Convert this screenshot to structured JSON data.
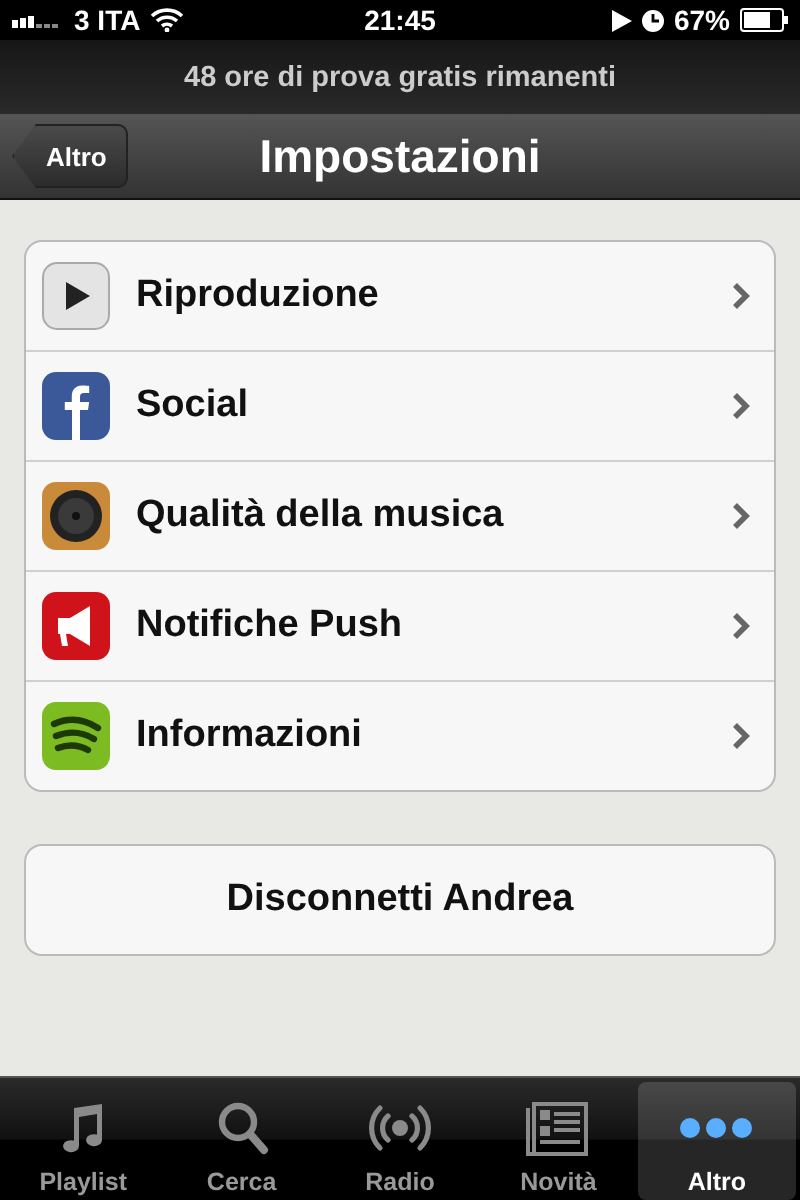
{
  "status_bar": {
    "carrier": "3 ITA",
    "time": "21:45",
    "battery": "67%"
  },
  "banner": "48 ore di prova gratis rimanenti",
  "nav": {
    "back": "Altro",
    "title": "Impostazioni"
  },
  "settings": [
    {
      "kind": "play",
      "label": "Riproduzione"
    },
    {
      "kind": "facebook",
      "label": "Social"
    },
    {
      "kind": "speaker",
      "label": "Qualità della musica"
    },
    {
      "kind": "megaphone",
      "label": "Notifiche Push"
    },
    {
      "kind": "waves",
      "label": "Informazioni"
    }
  ],
  "logout_button": "Disconnetti Andrea",
  "tabs": [
    {
      "kind": "music",
      "label": "Playlist",
      "selected": false
    },
    {
      "kind": "search",
      "label": "Cerca",
      "selected": false
    },
    {
      "kind": "radio",
      "label": "Radio",
      "selected": false
    },
    {
      "kind": "news",
      "label": "Novità",
      "selected": false
    },
    {
      "kind": "more",
      "label": "Altro",
      "selected": true
    }
  ]
}
